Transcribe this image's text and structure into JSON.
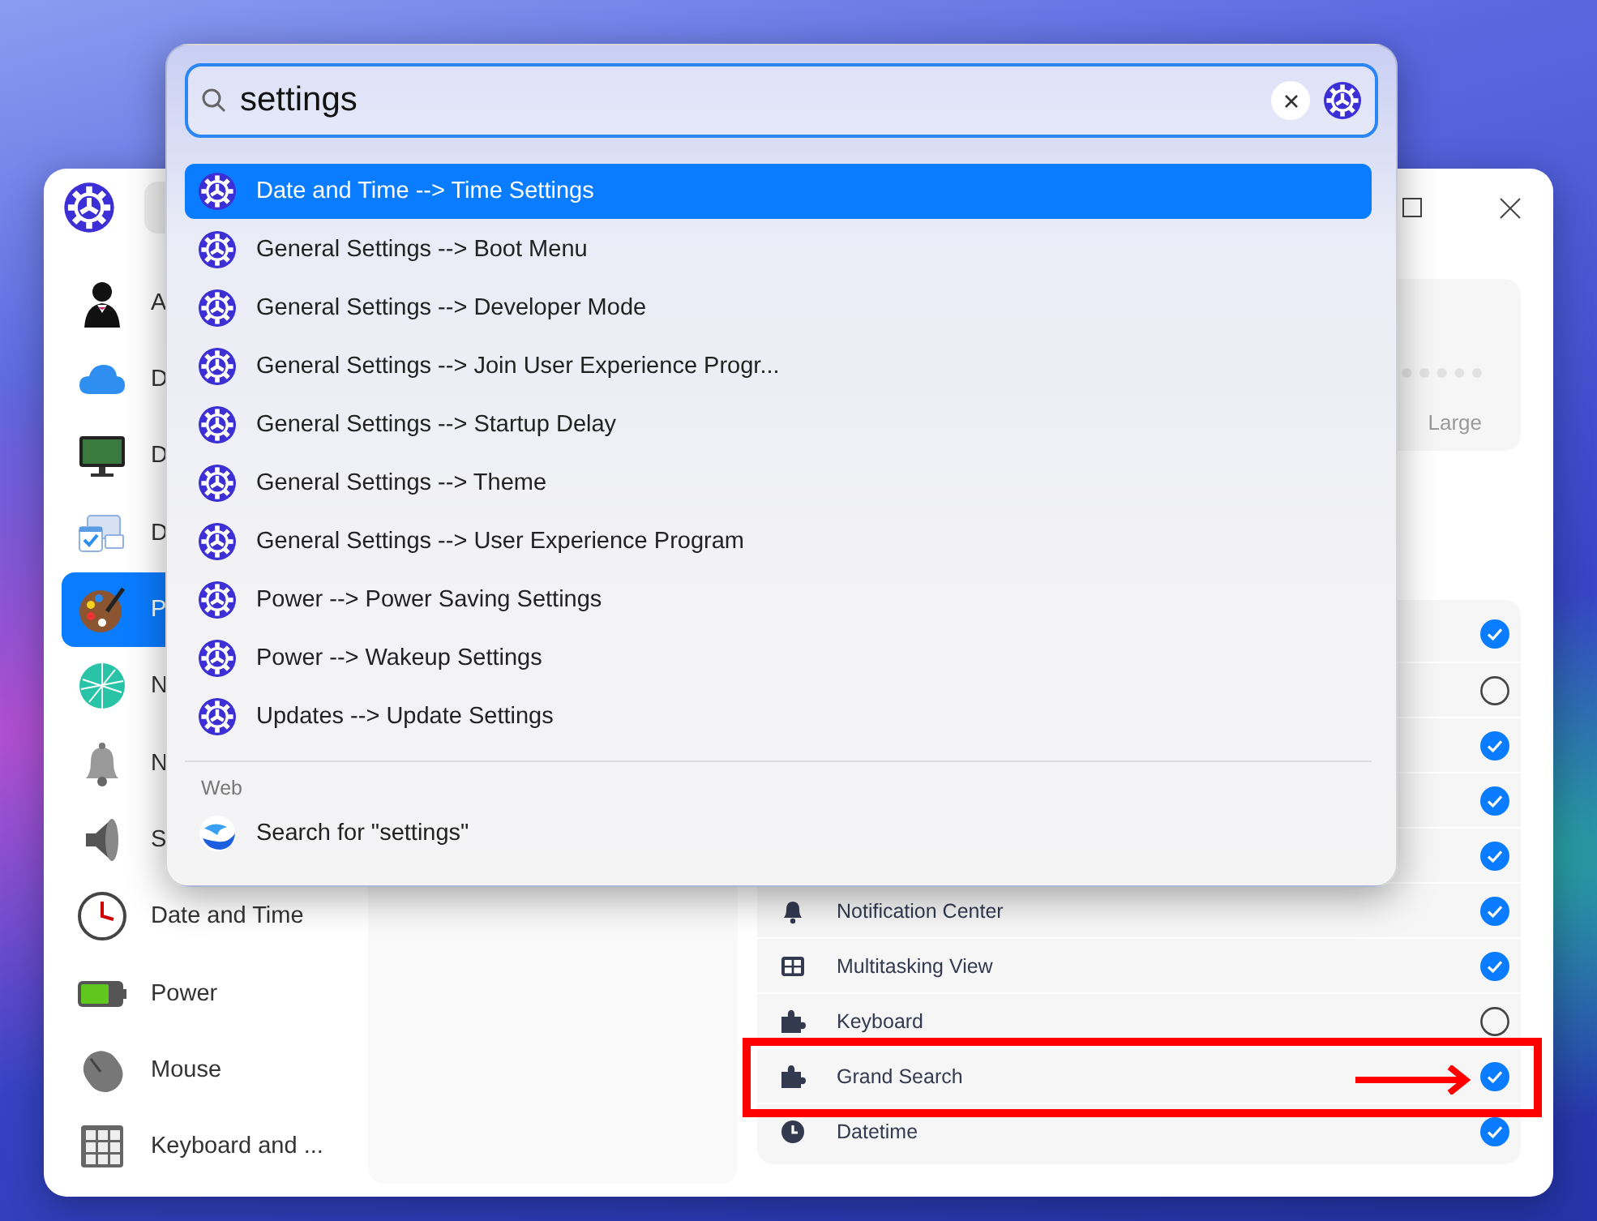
{
  "settings_window": {
    "sidebar": {
      "items": [
        {
          "label": "A",
          "selected": false
        },
        {
          "label": "D",
          "selected": false
        },
        {
          "label": "D",
          "selected": false
        },
        {
          "label": "D",
          "selected": false
        },
        {
          "label": "P",
          "selected": true
        },
        {
          "label": "N",
          "selected": false
        },
        {
          "label": "N",
          "selected": false
        },
        {
          "label": "S",
          "selected": false
        },
        {
          "label": "Date and Time",
          "selected": false
        },
        {
          "label": "Power",
          "selected": false
        },
        {
          "label": "Mouse",
          "selected": false
        },
        {
          "label": "Keyboard and ...",
          "selected": false
        }
      ]
    },
    "display_card": {
      "slider_label": "Large"
    },
    "plugin_list": {
      "rows": [
        {
          "checked": true,
          "highlighted": false
        },
        {
          "checked": false,
          "highlighted": false
        },
        {
          "checked": true,
          "highlighted": false
        },
        {
          "checked": true,
          "highlighted": false
        },
        {
          "checked": true,
          "highlighted": false
        },
        {
          "label": "Notification Center",
          "checked": true,
          "highlighted": false
        },
        {
          "label": "Multitasking View",
          "checked": true,
          "highlighted": false
        },
        {
          "label": "Keyboard",
          "checked": false,
          "highlighted": false
        },
        {
          "label": "Grand Search",
          "checked": true,
          "highlighted": true
        },
        {
          "label": "Datetime",
          "checked": true,
          "highlighted": false
        }
      ]
    }
  },
  "search_popup": {
    "query": "settings",
    "results": [
      {
        "text": "Date and Time --> Time Settings",
        "selected": true
      },
      {
        "text": "General Settings --> Boot Menu",
        "selected": false
      },
      {
        "text": "General Settings --> Developer Mode",
        "selected": false
      },
      {
        "text": "General Settings --> Join User Experience Progr...",
        "selected": false
      },
      {
        "text": "General Settings --> Startup Delay",
        "selected": false
      },
      {
        "text": "General Settings --> Theme",
        "selected": false
      },
      {
        "text": "General Settings --> User Experience Program",
        "selected": false
      },
      {
        "text": "Power --> Power Saving Settings",
        "selected": false
      },
      {
        "text": "Power --> Wakeup Settings",
        "selected": false
      },
      {
        "text": "Updates --> Update Settings",
        "selected": false
      }
    ],
    "web_section": {
      "heading": "Web",
      "results": [
        {
          "text": "Search for \"settings\""
        }
      ]
    }
  }
}
